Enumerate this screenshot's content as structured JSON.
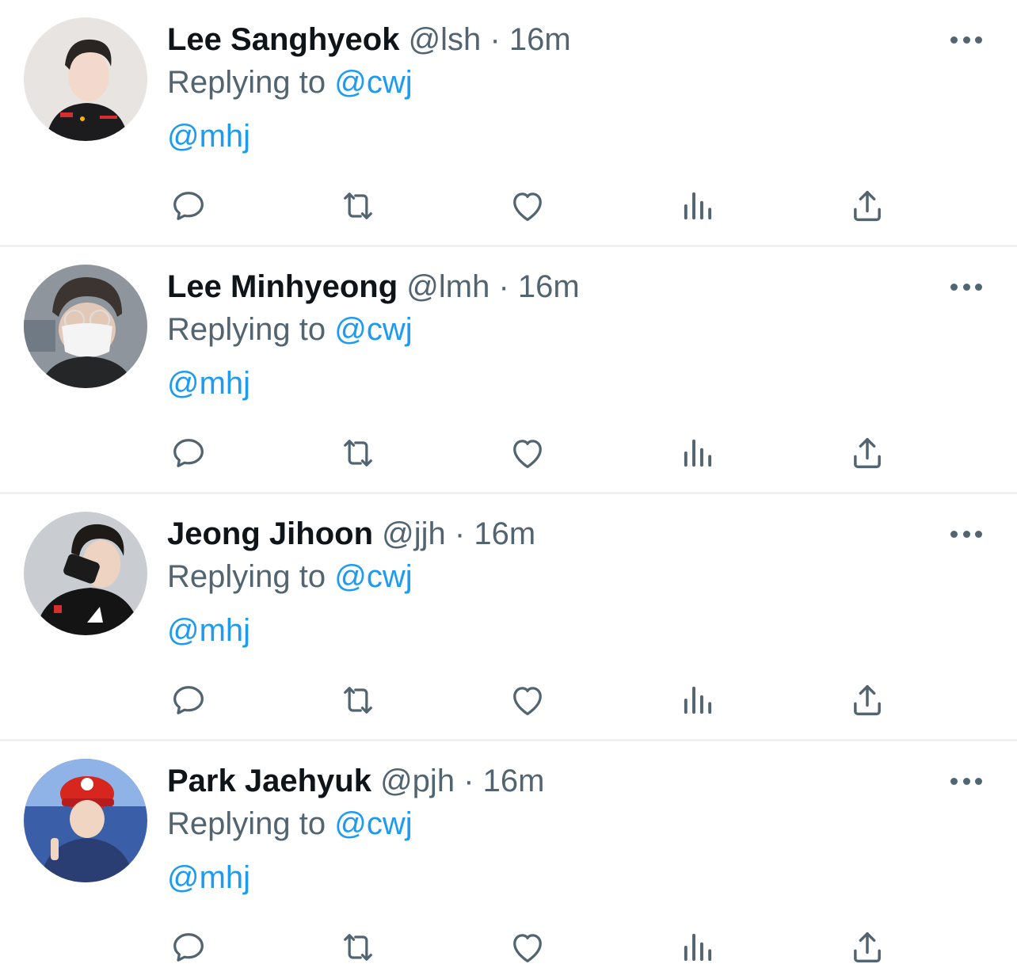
{
  "colors": {
    "text_primary": "#0f1419",
    "text_secondary": "#536471",
    "link": "#1d9bf0",
    "divider": "#eff1f3"
  },
  "tweets": [
    {
      "name": "Lee Sanghyeok",
      "handle": "@lsh",
      "separator": "·",
      "time": "16m",
      "replying_label": "Replying to",
      "replying_to": "@cwj",
      "text": "@mhj",
      "avatar_icon": "avatar-photo"
    },
    {
      "name": "Lee Minhyeong",
      "handle": "@lmh",
      "separator": "·",
      "time": "16m",
      "replying_label": "Replying to",
      "replying_to": "@cwj",
      "text": "@mhj",
      "avatar_icon": "avatar-photo"
    },
    {
      "name": "Jeong Jihoon",
      "handle": "@jjh",
      "separator": "·",
      "time": "16m",
      "replying_label": "Replying to",
      "replying_to": "@cwj",
      "text": "@mhj",
      "avatar_icon": "avatar-photo"
    },
    {
      "name": "Park Jaehyuk",
      "handle": "@pjh",
      "separator": "·",
      "time": "16m",
      "replying_label": "Replying to",
      "replying_to": "@cwj",
      "text": "@mhj",
      "avatar_icon": "avatar-photo"
    }
  ],
  "action_icons": [
    "reply-icon",
    "retweet-icon",
    "like-icon",
    "views-icon",
    "share-icon"
  ]
}
